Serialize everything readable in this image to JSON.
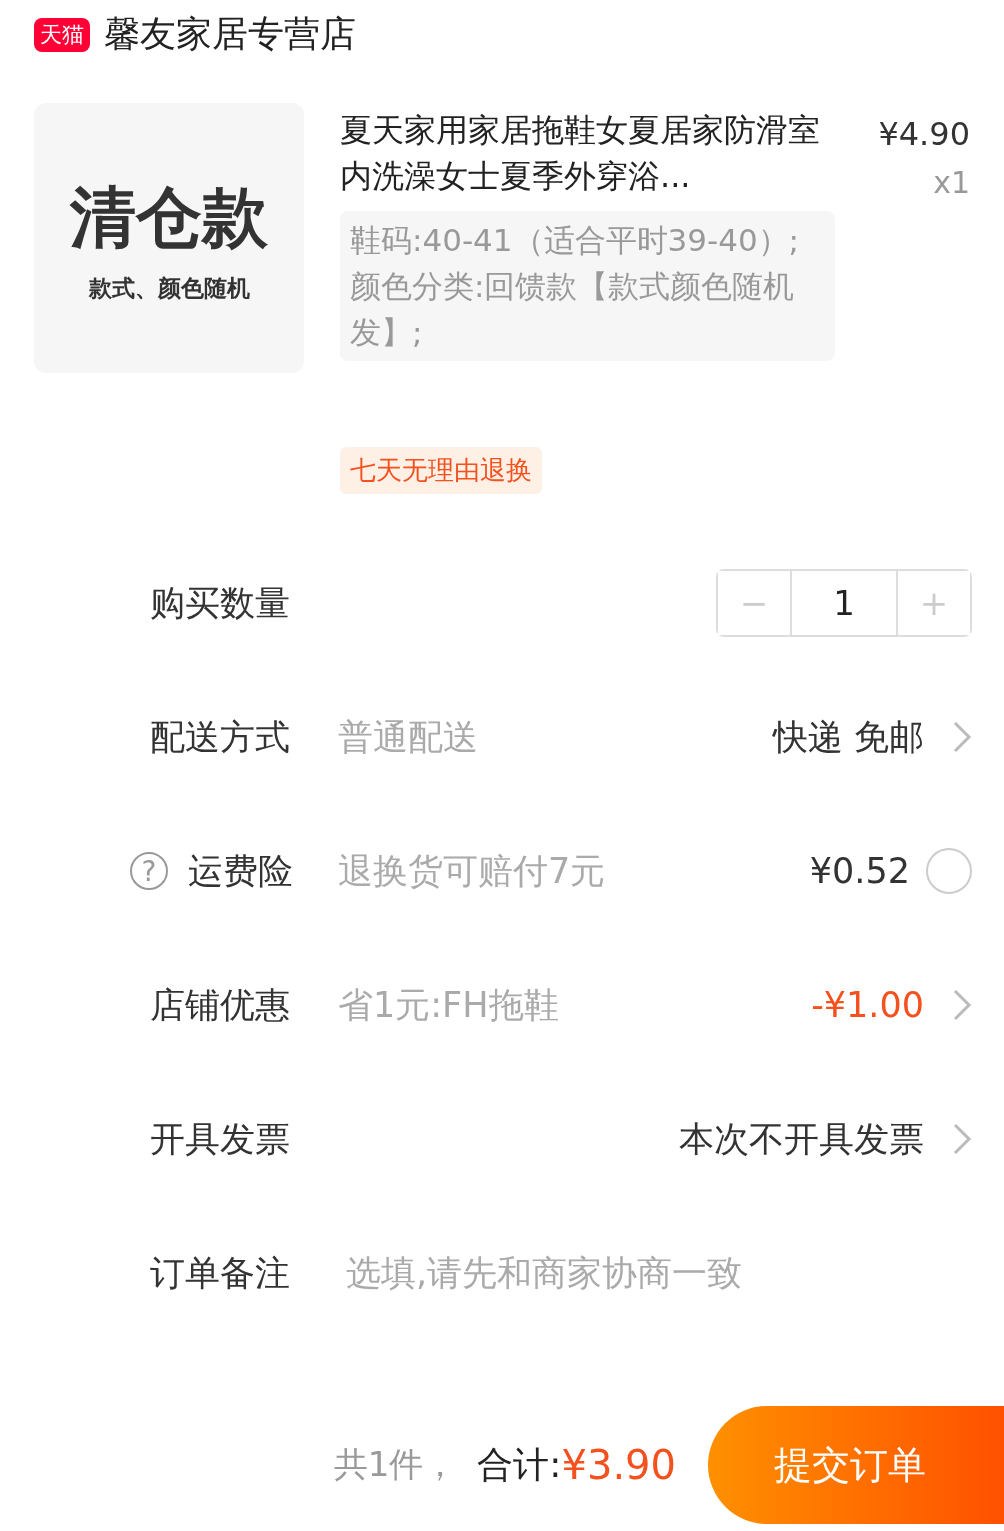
{
  "shop": {
    "badge": "天猫",
    "name": "馨友家居专营店"
  },
  "product": {
    "image": {
      "title": "清仓款",
      "subtitle": "款式、颜色随机"
    },
    "title": "夏天家用家居拖鞋女夏居家防滑室内洗澡女士夏季外穿浴...",
    "sku": "鞋码:40-41（适合平时39-40）;颜色分类:回馈款【款式颜色随机发】;",
    "price": "¥4.90",
    "qty": "x1",
    "tag": "七天无理由退换"
  },
  "rows": [
    {
      "kind": "stepper",
      "label": "购买数量",
      "minus": "−",
      "value": "1",
      "plus": "+"
    },
    {
      "kind": "select",
      "label": "配送方式",
      "desc": "普通配送",
      "value": "快递 免邮"
    },
    {
      "kind": "radio",
      "label": "运费险",
      "help": "?",
      "desc": "退换货可赔付7元",
      "value": "¥0.52",
      "selected": false
    },
    {
      "kind": "discount",
      "label": "店铺优惠",
      "desc": "省1元:FH拖鞋",
      "value": "-¥1.00"
    },
    {
      "kind": "select",
      "label": "开具发票",
      "value": "本次不开具发票"
    },
    {
      "kind": "field",
      "label": "订单备注",
      "placeholder": "选填,请先和商家协商一致"
    }
  ],
  "footer": {
    "count": "共1件，",
    "total_label": "合计:",
    "total": "¥3.90",
    "submit": "提交订单"
  }
}
